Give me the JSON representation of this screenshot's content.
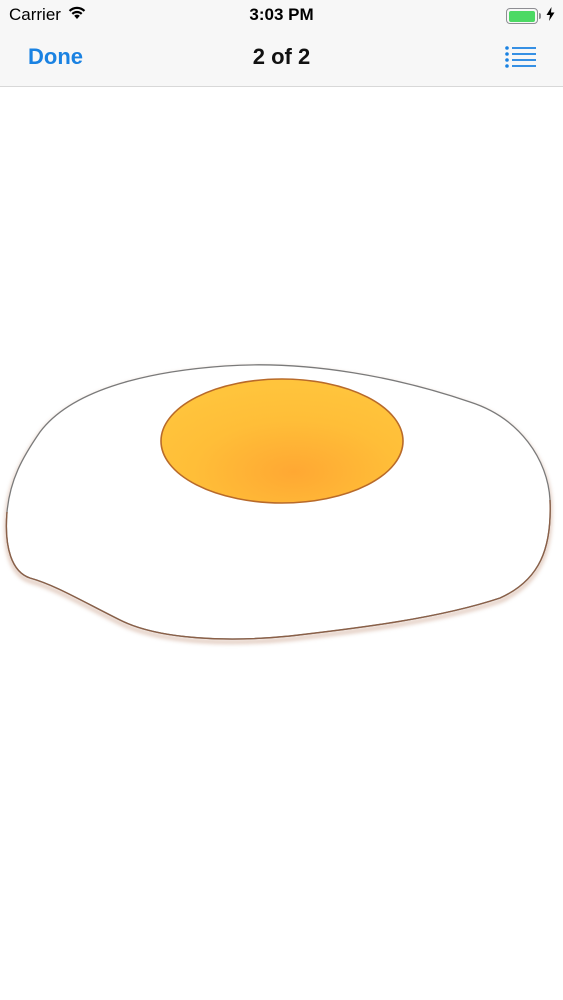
{
  "status_bar": {
    "carrier": "Carrier",
    "time": "3:03 PM",
    "battery_level": 1.0,
    "wifi_icon": "wifi-icon",
    "charging_icon": "bolt-icon"
  },
  "nav": {
    "done_label": "Done",
    "title": "2 of 2",
    "list_icon": "list-icon",
    "accent_color": "#1a82e2"
  },
  "content": {
    "image": "fried-egg-drawing"
  }
}
